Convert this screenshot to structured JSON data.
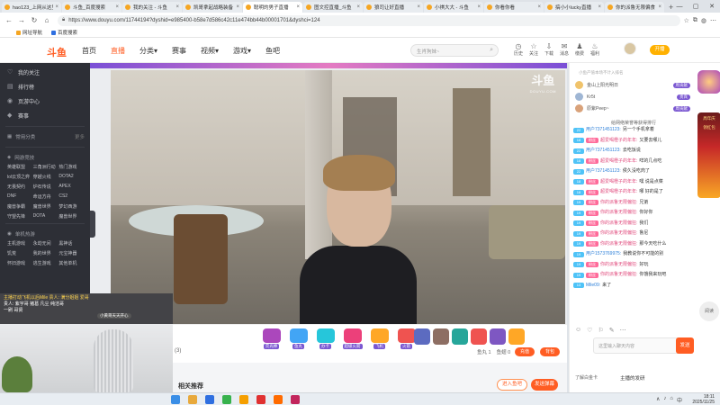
{
  "browser": {
    "tabs": [
      {
        "title": "hao123_上网从这里开始",
        "active": false
      },
      {
        "title": "斗鱼_百度搜索",
        "active": false
      },
      {
        "title": "我的关注 - 斗鱼",
        "active": false
      },
      {
        "title": "凯哥拿起战略装备",
        "active": false
      },
      {
        "title": "聪明的男子直播",
        "active": true
      },
      {
        "title": "图文控直播_斗鱼",
        "active": false
      },
      {
        "title": "狼司让好直播",
        "active": false
      },
      {
        "title": "小祺大大 - 斗鱼",
        "active": false
      },
      {
        "title": "你看你看",
        "active": false
      },
      {
        "title": "搞小小lucky直播",
        "active": false
      },
      {
        "title": "你的派鲁无限偏食",
        "active": false
      }
    ],
    "new_tab": "+",
    "window_controls": [
      "—",
      "▢",
      "✕"
    ],
    "url": "https://www.douyu.com/11744194?dyshid=e985400-b58e7d586c42c11e474bb44b00001701&dyshci=124",
    "bookmarks": [
      "网址导航",
      "百度搜索"
    ]
  },
  "site": {
    "logo_text": "斗鱼",
    "nav": [
      "首页",
      "直播",
      "分类",
      "赛事",
      "视频",
      "游戏",
      "鱼吧"
    ],
    "nav_active": "直播",
    "search_placeholder": "生肖狗妹~",
    "header_icons": [
      {
        "label": "历史",
        "glyph": "◷"
      },
      {
        "label": "关注",
        "glyph": "☆"
      },
      {
        "label": "下载",
        "glyph": "⇩"
      },
      {
        "label": "消息",
        "glyph": "✉"
      },
      {
        "label": "缴费",
        "glyph": "♟"
      },
      {
        "label": "福利",
        "glyph": "♨"
      }
    ],
    "open_btn": "开播"
  },
  "sidebar": {
    "top_items": [
      {
        "label": "我的关注",
        "icon": "♡"
      },
      {
        "label": "排行榜",
        "icon": "▤"
      },
      {
        "label": "页游中心",
        "icon": "◉"
      },
      {
        "label": "赛事",
        "icon": "◆"
      }
    ],
    "sec1": {
      "title": "常用分类",
      "more": "更多"
    },
    "sec2": {
      "title": "网游竞技",
      "items": [
        "英雄联盟",
        "三角洲行动",
        "热门游戏",
        "lol云顶之弈",
        "穿越火线",
        "DOTA2",
        "无畏契约",
        "炉石传说",
        "APEX",
        "DNF",
        "命运方舟",
        "CS2",
        "魔兽争霸",
        "魔兽世界",
        "梦幻西游",
        "守望先锋",
        "DOTA",
        "魔兽世界"
      ]
    },
    "sec3": {
      "title": "单机热游",
      "items": [
        "主机游戏",
        "永劫无间",
        "黑神话",
        "饥荒",
        "我的世界",
        "元宝神器",
        "怀旧游戏",
        "逃生游戏",
        "其他单机"
      ]
    }
  },
  "video": {
    "watermark": "斗鱼",
    "watermark_sub": "DOUYU.COM"
  },
  "giftbar": {
    "gifts": [
      "荧光棒",
      "鱼丸",
      "办卡",
      "超级火箭",
      "飞机",
      "火箭"
    ],
    "count": "(3)",
    "fish": [
      "鱼丸 1",
      "鱼翅 0"
    ],
    "charge_btn": "充值",
    "gift_btn": "背包"
  },
  "bottom": {
    "related": "相关推荐",
    "join_btn": "进入鱼吧",
    "follow_btn": "发送弹幕"
  },
  "rank": {
    "tip": "小鱼产值本场不计入排名",
    "rows": [
      {
        "name": "金山上阳光明日",
        "badge": "周贡献"
      },
      {
        "name": "Kr5t",
        "badge": "贵宾"
      },
      {
        "name": "原紫Peep~",
        "badge": "周贡献"
      }
    ],
    "more": "给网络荣誉等获得排行"
  },
  "chat": [
    {
      "lv": "22",
      "fan": "",
      "nick": "用户7371451123:",
      "pink": false,
      "text": "另一个手机拿着"
    },
    {
      "lv": "18",
      "fan": "粉丝",
      "nick": "超爱喝橙子的年年:",
      "pink": true,
      "text": "又要去哪儿"
    },
    {
      "lv": "22",
      "fan": "",
      "nick": "用户7371451123:",
      "pink": false,
      "text": "去吃饭说"
    },
    {
      "lv": "18",
      "fan": "粉丝",
      "nick": "超爱喝橙子的年年:",
      "pink": true,
      "text": "咩的几点吃"
    },
    {
      "lv": "22",
      "fan": "",
      "nick": "用户7371451123:",
      "pink": false,
      "text": "侯久没吃肉了"
    },
    {
      "lv": "18",
      "fan": "粉丝",
      "nick": "超爱喝橙子的年年:",
      "pink": true,
      "text": "嘿 说是点菜"
    },
    {
      "lv": "18",
      "fan": "粉丝",
      "nick": "超爱喝橙子的年年:",
      "pink": true,
      "text": "哪 好的是了"
    },
    {
      "lv": "19",
      "fan": "粉丝",
      "nick": "你的派鲁无限偏狂:",
      "pink": true,
      "text": "兄弟"
    },
    {
      "lv": "19",
      "fan": "粉丝",
      "nick": "你的派鲁无限偏狂:",
      "pink": true,
      "text": "你好你"
    },
    {
      "lv": "19",
      "fan": "粉丝",
      "nick": "你的派鲁无限偏狂:",
      "pink": true,
      "text": "我们"
    },
    {
      "lv": "19",
      "fan": "粉丝",
      "nick": "你的派鲁无限偏狂:",
      "pink": true,
      "text": "鲁尼"
    },
    {
      "lv": "19",
      "fan": "粉丝",
      "nick": "你的派鲁无限偏狂:",
      "pink": true,
      "text": "那今天吃什么"
    },
    {
      "lv": "19",
      "fan": "",
      "nick": "用户1573769975:",
      "pink": false,
      "text": "我教说你不可能的别"
    },
    {
      "lv": "19",
      "fan": "粉丝",
      "nick": "你的派鲁无限偏狂:",
      "pink": true,
      "text": "好玩"
    },
    {
      "lv": "19",
      "fan": "粉丝",
      "nick": "你的派鲁无限偏狂:",
      "pink": true,
      "text": "你饿我来玩吧"
    },
    {
      "lv": "13",
      "fan": "",
      "nick": "Mile09:",
      "pink": false,
      "text": "来了"
    }
  ],
  "chat_tools": [
    "☺",
    "♡",
    "⚐",
    "✎",
    "⋯"
  ],
  "chat_input_placeholder": "这里输入聊天内容",
  "send_btn": "发送",
  "right_bottom": {
    "left": "了解白金卡",
    "center": "主播的发研"
  },
  "ad_side": {
    "top_label": "周年庆",
    "mid_label": "领红包",
    "bottom_label": "阅读"
  },
  "pip": {
    "line1": "主播打动飞机以后Mile  贵人:  满分姐姐  爱哥",
    "line2": "贵人:  紫宇哥  猪葛  凡尘  纯洁哥",
    "line3": "一刷  哥贤",
    "badge": "小黄哥天天开心"
  },
  "taskbar": {
    "time": "18:11",
    "date": "2025/11/25",
    "tray": [
      "∧",
      "♪",
      "⌂",
      "中"
    ]
  }
}
